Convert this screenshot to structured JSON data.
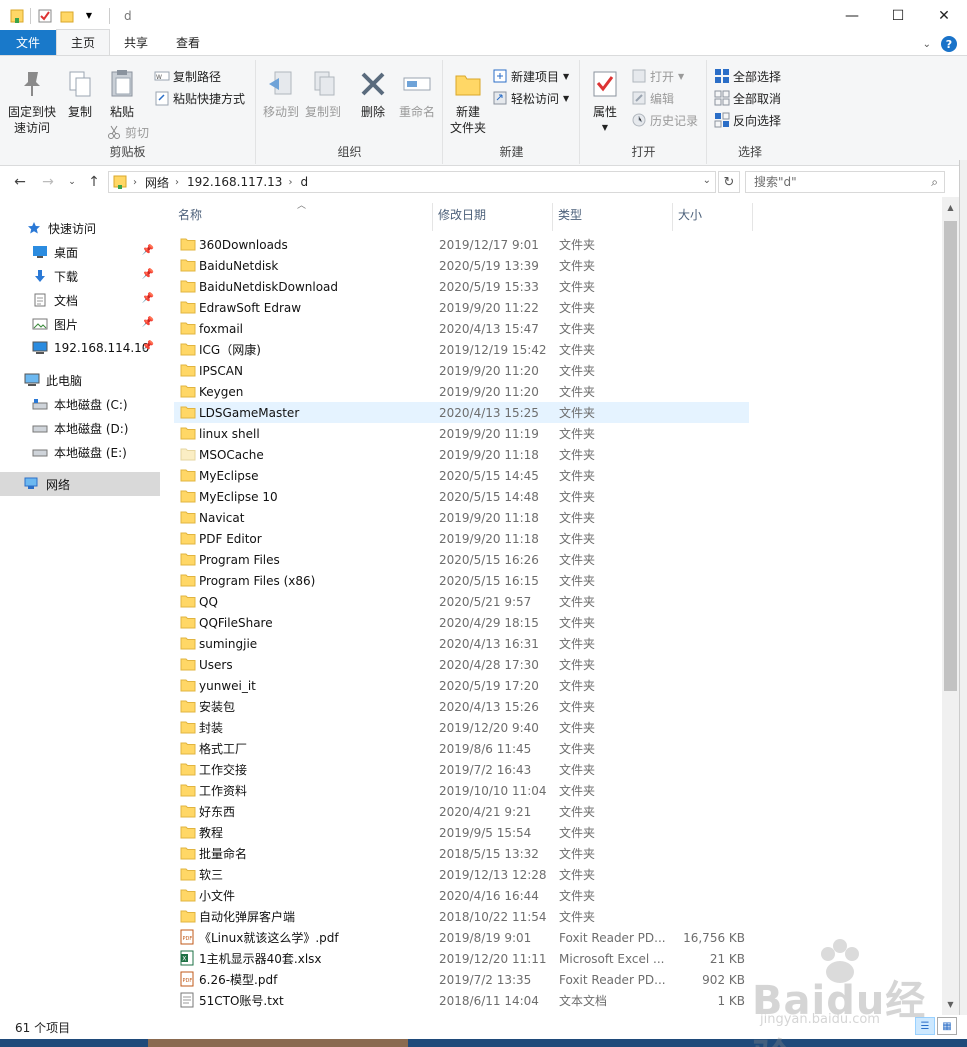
{
  "window": {
    "title": "d",
    "minimize": "—",
    "maximize": "☐",
    "close": "✕"
  },
  "ribbon_tabs": {
    "file": "文件",
    "home": "主页",
    "share": "共享",
    "view": "查看"
  },
  "ribbon": {
    "clipboard": {
      "label": "剪贴板",
      "pin_line1": "固定到快",
      "pin_line2": "速访问",
      "copy": "复制",
      "paste": "粘贴",
      "copy_path": "复制路径",
      "paste_shortcut": "粘贴快捷方式",
      "cut": "剪切"
    },
    "organize": {
      "label": "组织",
      "move_to": "移动到",
      "copy_to": "复制到",
      "delete": "删除",
      "rename": "重命名"
    },
    "new": {
      "label": "新建",
      "new_folder_line1": "新建",
      "new_folder_line2": "文件夹",
      "new_item": "新建项目",
      "easy_access": "轻松访问"
    },
    "open": {
      "label": "打开",
      "properties": "属性",
      "open": "打开",
      "edit": "编辑",
      "history": "历史记录"
    },
    "select": {
      "label": "选择",
      "select_all": "全部选择",
      "select_none": "全部取消",
      "invert": "反向选择"
    }
  },
  "address": {
    "segments": [
      "网络",
      "192.168.117.13",
      "d"
    ],
    "search_placeholder": "搜索\"d\""
  },
  "nav_pane": {
    "quick_access": "快速访问",
    "desktop": "桌面",
    "downloads": "下载",
    "documents": "文档",
    "pictures": "图片",
    "remote": "192.168.114.10",
    "this_pc": "此电脑",
    "drive_c": "本地磁盘 (C:)",
    "drive_d": "本地磁盘 (D:)",
    "drive_e": "本地磁盘 (E:)",
    "network": "网络"
  },
  "columns": {
    "name": "名称",
    "date": "修改日期",
    "type": "类型",
    "size": "大小"
  },
  "files": [
    {
      "name": "360Downloads",
      "date": "2019/12/17 9:01",
      "type": "文件夹",
      "size": "",
      "kind": "folder"
    },
    {
      "name": "BaiduNetdisk",
      "date": "2020/5/19 13:39",
      "type": "文件夹",
      "size": "",
      "kind": "folder"
    },
    {
      "name": "BaiduNetdiskDownload",
      "date": "2020/5/19 15:33",
      "type": "文件夹",
      "size": "",
      "kind": "folder"
    },
    {
      "name": "EdrawSoft Edraw",
      "date": "2019/9/20 11:22",
      "type": "文件夹",
      "size": "",
      "kind": "folder"
    },
    {
      "name": "foxmail",
      "date": "2020/4/13 15:47",
      "type": "文件夹",
      "size": "",
      "kind": "folder"
    },
    {
      "name": "ICG（网康)",
      "date": "2019/12/19 15:42",
      "type": "文件夹",
      "size": "",
      "kind": "folder"
    },
    {
      "name": "IPSCAN",
      "date": "2019/9/20 11:20",
      "type": "文件夹",
      "size": "",
      "kind": "folder"
    },
    {
      "name": "Keygen",
      "date": "2019/9/20 11:20",
      "type": "文件夹",
      "size": "",
      "kind": "folder"
    },
    {
      "name": "LDSGameMaster",
      "date": "2020/4/13 15:25",
      "type": "文件夹",
      "size": "",
      "kind": "folder"
    },
    {
      "name": "linux shell",
      "date": "2019/9/20 11:19",
      "type": "文件夹",
      "size": "",
      "kind": "folder"
    },
    {
      "name": "MSOCache",
      "date": "2019/9/20 11:18",
      "type": "文件夹",
      "size": "",
      "kind": "folder-faded"
    },
    {
      "name": "MyEclipse",
      "date": "2020/5/15 14:45",
      "type": "文件夹",
      "size": "",
      "kind": "folder"
    },
    {
      "name": "MyEclipse 10",
      "date": "2020/5/15 14:48",
      "type": "文件夹",
      "size": "",
      "kind": "folder"
    },
    {
      "name": "Navicat",
      "date": "2019/9/20 11:18",
      "type": "文件夹",
      "size": "",
      "kind": "folder"
    },
    {
      "name": "PDF Editor",
      "date": "2019/9/20 11:18",
      "type": "文件夹",
      "size": "",
      "kind": "folder"
    },
    {
      "name": "Program Files",
      "date": "2020/5/15 16:26",
      "type": "文件夹",
      "size": "",
      "kind": "folder"
    },
    {
      "name": "Program Files (x86)",
      "date": "2020/5/15 16:15",
      "type": "文件夹",
      "size": "",
      "kind": "folder"
    },
    {
      "name": "QQ",
      "date": "2020/5/21 9:57",
      "type": "文件夹",
      "size": "",
      "kind": "folder"
    },
    {
      "name": "QQFileShare",
      "date": "2020/4/29 18:15",
      "type": "文件夹",
      "size": "",
      "kind": "folder"
    },
    {
      "name": "sumingjie",
      "date": "2020/4/13 16:31",
      "type": "文件夹",
      "size": "",
      "kind": "folder"
    },
    {
      "name": "Users",
      "date": "2020/4/28 17:30",
      "type": "文件夹",
      "size": "",
      "kind": "folder"
    },
    {
      "name": "yunwei_it",
      "date": "2020/5/19 17:20",
      "type": "文件夹",
      "size": "",
      "kind": "folder"
    },
    {
      "name": "安装包",
      "date": "2020/4/13 15:26",
      "type": "文件夹",
      "size": "",
      "kind": "folder"
    },
    {
      "name": "封装",
      "date": "2019/12/20 9:40",
      "type": "文件夹",
      "size": "",
      "kind": "folder"
    },
    {
      "name": "格式工厂",
      "date": "2019/8/6 11:45",
      "type": "文件夹",
      "size": "",
      "kind": "folder"
    },
    {
      "name": "工作交接",
      "date": "2019/7/2 16:43",
      "type": "文件夹",
      "size": "",
      "kind": "folder"
    },
    {
      "name": "工作资料",
      "date": "2019/10/10 11:04",
      "type": "文件夹",
      "size": "",
      "kind": "folder"
    },
    {
      "name": "好东西",
      "date": "2020/4/21 9:21",
      "type": "文件夹",
      "size": "",
      "kind": "folder"
    },
    {
      "name": "教程",
      "date": "2019/9/5 15:54",
      "type": "文件夹",
      "size": "",
      "kind": "folder"
    },
    {
      "name": "批量命名",
      "date": "2018/5/15 13:32",
      "type": "文件夹",
      "size": "",
      "kind": "folder"
    },
    {
      "name": "软三",
      "date": "2019/12/13 12:28",
      "type": "文件夹",
      "size": "",
      "kind": "folder"
    },
    {
      "name": "小文件",
      "date": "2020/4/16 16:44",
      "type": "文件夹",
      "size": "",
      "kind": "folder"
    },
    {
      "name": "自动化弹屏客户端",
      "date": "2018/10/22 11:54",
      "type": "文件夹",
      "size": "",
      "kind": "folder"
    },
    {
      "name": "《Linux就该这么学》.pdf",
      "date": "2019/8/19 9:01",
      "type": "Foxit Reader PD...",
      "size": "16,756 KB",
      "kind": "pdf"
    },
    {
      "name": "1主机显示器40套.xlsx",
      "date": "2019/12/20 11:11",
      "type": "Microsoft Excel ...",
      "size": "21 KB",
      "kind": "xlsx"
    },
    {
      "name": "6.26-模型.pdf",
      "date": "2019/7/2 13:35",
      "type": "Foxit Reader PD...",
      "size": "902 KB",
      "kind": "pdf"
    },
    {
      "name": "51CTO账号.txt",
      "date": "2018/6/11 14:04",
      "type": "文本文档",
      "size": "1 KB",
      "kind": "txt"
    }
  ],
  "status": {
    "item_count": "61 个项目"
  },
  "watermark": {
    "brand": "Baidu经验",
    "url": "jingyan.baidu.com"
  },
  "colors": {
    "file_tab": "#1979ca",
    "folder": "#ffd766",
    "hover_row": "#e5f3ff",
    "selected_nav": "#d9d9d9",
    "header_text": "#4c607a"
  }
}
